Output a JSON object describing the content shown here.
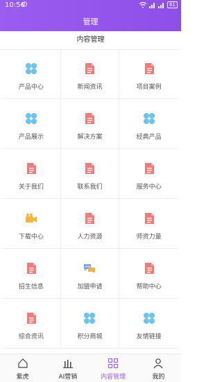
{
  "status_bar": {
    "time": "10:56",
    "battery": "61"
  },
  "header": {
    "title": "管理"
  },
  "section": {
    "title": "内容管理"
  },
  "grid": [
    {
      "label": "产品中心",
      "icon": "grid-flower-icon"
    },
    {
      "label": "新闻资讯",
      "icon": "document-icon"
    },
    {
      "label": "项目案例",
      "icon": "document-icon"
    },
    {
      "label": "产品展示",
      "icon": "grid-flower-icon"
    },
    {
      "label": "解决方案",
      "icon": "document-icon"
    },
    {
      "label": "经典产品",
      "icon": "grid-flower-icon"
    },
    {
      "label": "关于我们",
      "icon": "document-icon"
    },
    {
      "label": "联系我们",
      "icon": "document-icon"
    },
    {
      "label": "服务中心",
      "icon": "document-icon"
    },
    {
      "label": "下载中心",
      "icon": "video-camera-icon"
    },
    {
      "label": "人力资源",
      "icon": "document-icon"
    },
    {
      "label": "师资力量",
      "icon": "document-icon"
    },
    {
      "label": "招生信息",
      "icon": "document-icon"
    },
    {
      "label": "加盟申请",
      "icon": "chat-bubbles-icon"
    },
    {
      "label": "帮助中心",
      "icon": "document-icon"
    },
    {
      "label": "综合资讯",
      "icon": "document-icon"
    },
    {
      "label": "积分商城",
      "icon": "grid-flower-icon"
    },
    {
      "label": "友情链接",
      "icon": "grid-flower-icon"
    }
  ],
  "bottom_nav": [
    {
      "label": "紫虎",
      "icon": "home-icon"
    },
    {
      "label": "AI营销",
      "icon": "bar-chart-icon"
    },
    {
      "label": "内容管理",
      "icon": "grid-squares-icon",
      "active": true
    },
    {
      "label": "我的",
      "icon": "user-icon"
    }
  ],
  "colors": {
    "brand": "#9b5cf0",
    "doc_icon": "#ef7c7c",
    "flower_icon": "#6cc3ee",
    "camera_icon": "#f5b53a",
    "chat_icon": "#7aa3f0"
  }
}
